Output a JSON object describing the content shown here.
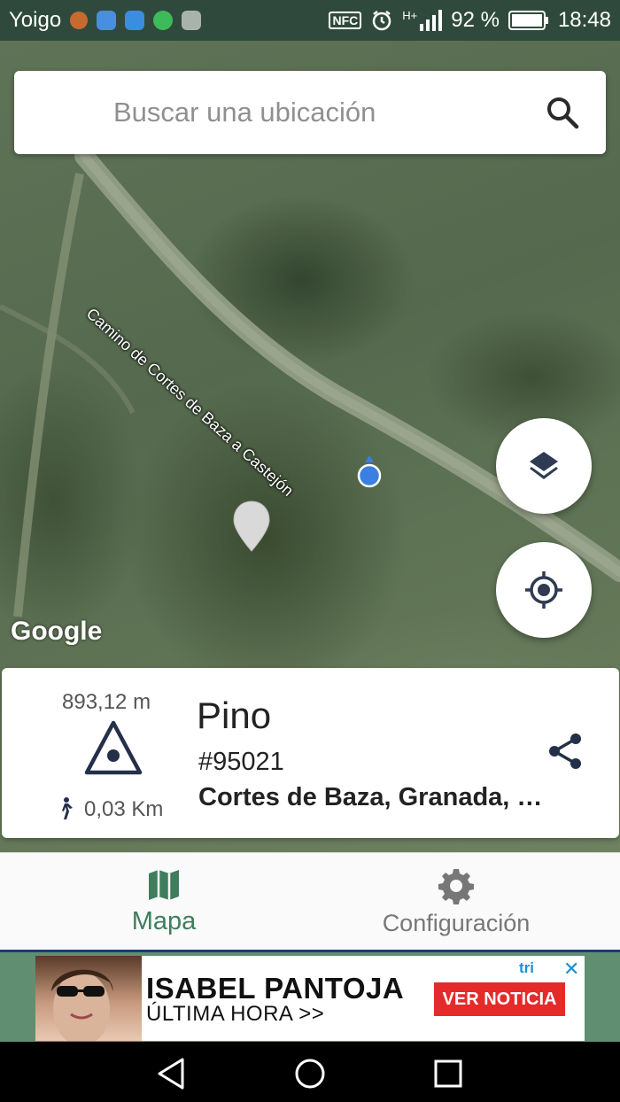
{
  "status_bar": {
    "carrier": "Yoigo",
    "battery_percent": "92 %",
    "time": "18:48",
    "nfc_label": "NFC",
    "network_label": "H+"
  },
  "search": {
    "placeholder": "Buscar una ubicación"
  },
  "map": {
    "road_label": "Camino de Cortes de Baza a Castejón",
    "provider_logo": "Google"
  },
  "info_card": {
    "elevation": "893,12 m",
    "distance": "0,03 Km",
    "name": "Pino",
    "id": "#95021",
    "address": "Cortes de Baza, Granada, …"
  },
  "bottom_nav": {
    "items": [
      {
        "label": "Mapa",
        "icon": "map-icon",
        "active": true
      },
      {
        "label": "Configuración",
        "icon": "gear-icon",
        "active": false
      }
    ]
  },
  "ad": {
    "title": "ISABEL PANTOJA",
    "subtitle": "ÚLTIMA HORA >>",
    "cta": "VER NOTICIA",
    "choices": "tri",
    "close": "✕"
  },
  "colors": {
    "status_bar_bg": "#2f4a3c",
    "active_tab": "#3f7d5d",
    "ad_cta_bg": "#e52a2a"
  }
}
